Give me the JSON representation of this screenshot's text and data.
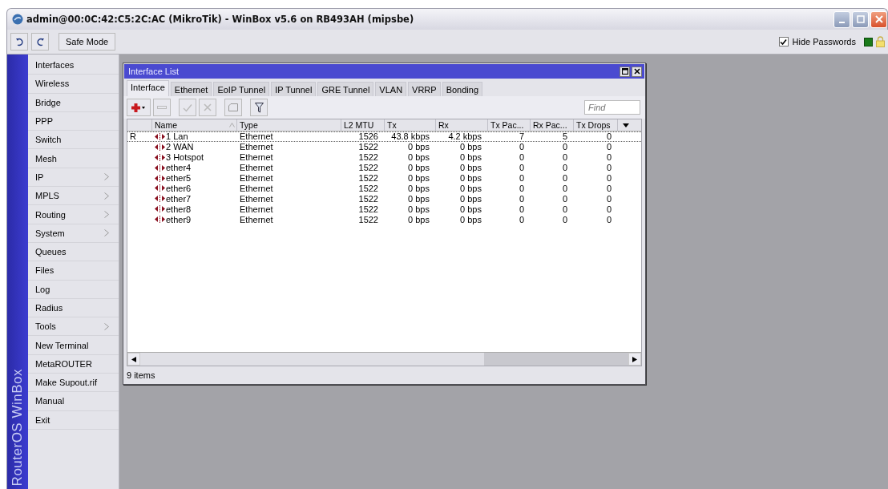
{
  "window": {
    "title": "admin@00:0C:42:C5:2C:AC (MikroTik) - WinBox v5.6 on RB493AH (mipsbe)"
  },
  "toolbar": {
    "safe_mode": "Safe Mode",
    "hide_passwords": {
      "label": "Hide Passwords",
      "checked": true
    }
  },
  "sidebar": {
    "brand": "RouterOS WinBox",
    "items": [
      {
        "label": "Interfaces",
        "submenu": false
      },
      {
        "label": "Wireless",
        "submenu": false
      },
      {
        "label": "Bridge",
        "submenu": false
      },
      {
        "label": "PPP",
        "submenu": false
      },
      {
        "label": "Switch",
        "submenu": false
      },
      {
        "label": "Mesh",
        "submenu": false
      },
      {
        "label": "IP",
        "submenu": true
      },
      {
        "label": "MPLS",
        "submenu": true
      },
      {
        "label": "Routing",
        "submenu": true
      },
      {
        "label": "System",
        "submenu": true
      },
      {
        "label": "Queues",
        "submenu": false
      },
      {
        "label": "Files",
        "submenu": false
      },
      {
        "label": "Log",
        "submenu": false
      },
      {
        "label": "Radius",
        "submenu": false
      },
      {
        "label": "Tools",
        "submenu": true
      },
      {
        "label": "New Terminal",
        "submenu": false
      },
      {
        "label": "MetaROUTER",
        "submenu": false
      },
      {
        "label": "Make Supout.rif",
        "submenu": false
      },
      {
        "label": "Manual",
        "submenu": false
      },
      {
        "label": "Exit",
        "submenu": false
      }
    ]
  },
  "interface_list": {
    "title": "Interface List",
    "tabs": [
      {
        "label": "Interface",
        "selected": true
      },
      {
        "label": "Ethernet",
        "selected": false
      },
      {
        "label": "EoIP Tunnel",
        "selected": false
      },
      {
        "label": "IP Tunnel",
        "selected": false
      },
      {
        "label": "GRE Tunnel",
        "selected": false
      },
      {
        "label": "VLAN",
        "selected": false
      },
      {
        "label": "VRRP",
        "selected": false
      },
      {
        "label": "Bonding",
        "selected": false
      }
    ],
    "find": {
      "placeholder": "Find"
    },
    "columns": [
      {
        "label": "Name",
        "sorted": true
      },
      {
        "label": "Type",
        "sorted": false
      },
      {
        "label": "L2 MTU",
        "sorted": false
      },
      {
        "label": "Tx",
        "sorted": false
      },
      {
        "label": "Rx",
        "sorted": false
      },
      {
        "label": "Tx Pac...",
        "sorted": false
      },
      {
        "label": "Rx Pac...",
        "sorted": false
      },
      {
        "label": "Tx Drops",
        "sorted": false
      }
    ],
    "rows": [
      {
        "flag": "R",
        "cells": [
          "1 Lan",
          "Ethernet",
          "1526",
          "43.8 kbps",
          "4.2 kbps",
          "7",
          "5",
          "0"
        ]
      },
      {
        "cells": [
          "2 WAN",
          "Ethernet",
          "1522",
          "0 bps",
          "0 bps",
          "0",
          "0",
          "0"
        ]
      },
      {
        "cells": [
          "3 Hotspot",
          "Ethernet",
          "1522",
          "0 bps",
          "0 bps",
          "0",
          "0",
          "0"
        ]
      },
      {
        "cells": [
          "ether4",
          "Ethernet",
          "1522",
          "0 bps",
          "0 bps",
          "0",
          "0",
          "0"
        ]
      },
      {
        "cells": [
          "ether5",
          "Ethernet",
          "1522",
          "0 bps",
          "0 bps",
          "0",
          "0",
          "0"
        ]
      },
      {
        "cells": [
          "ether6",
          "Ethernet",
          "1522",
          "0 bps",
          "0 bps",
          "0",
          "0",
          "0"
        ]
      },
      {
        "cells": [
          "ether7",
          "Ethernet",
          "1522",
          "0 bps",
          "0 bps",
          "0",
          "0",
          "0"
        ]
      },
      {
        "cells": [
          "ether8",
          "Ethernet",
          "1522",
          "0 bps",
          "0 bps",
          "0",
          "0",
          "0"
        ]
      },
      {
        "cells": [
          "ether9",
          "Ethernet",
          "1522",
          "0 bps",
          "0 bps",
          "0",
          "0",
          "0"
        ]
      }
    ],
    "status": "9 items"
  }
}
